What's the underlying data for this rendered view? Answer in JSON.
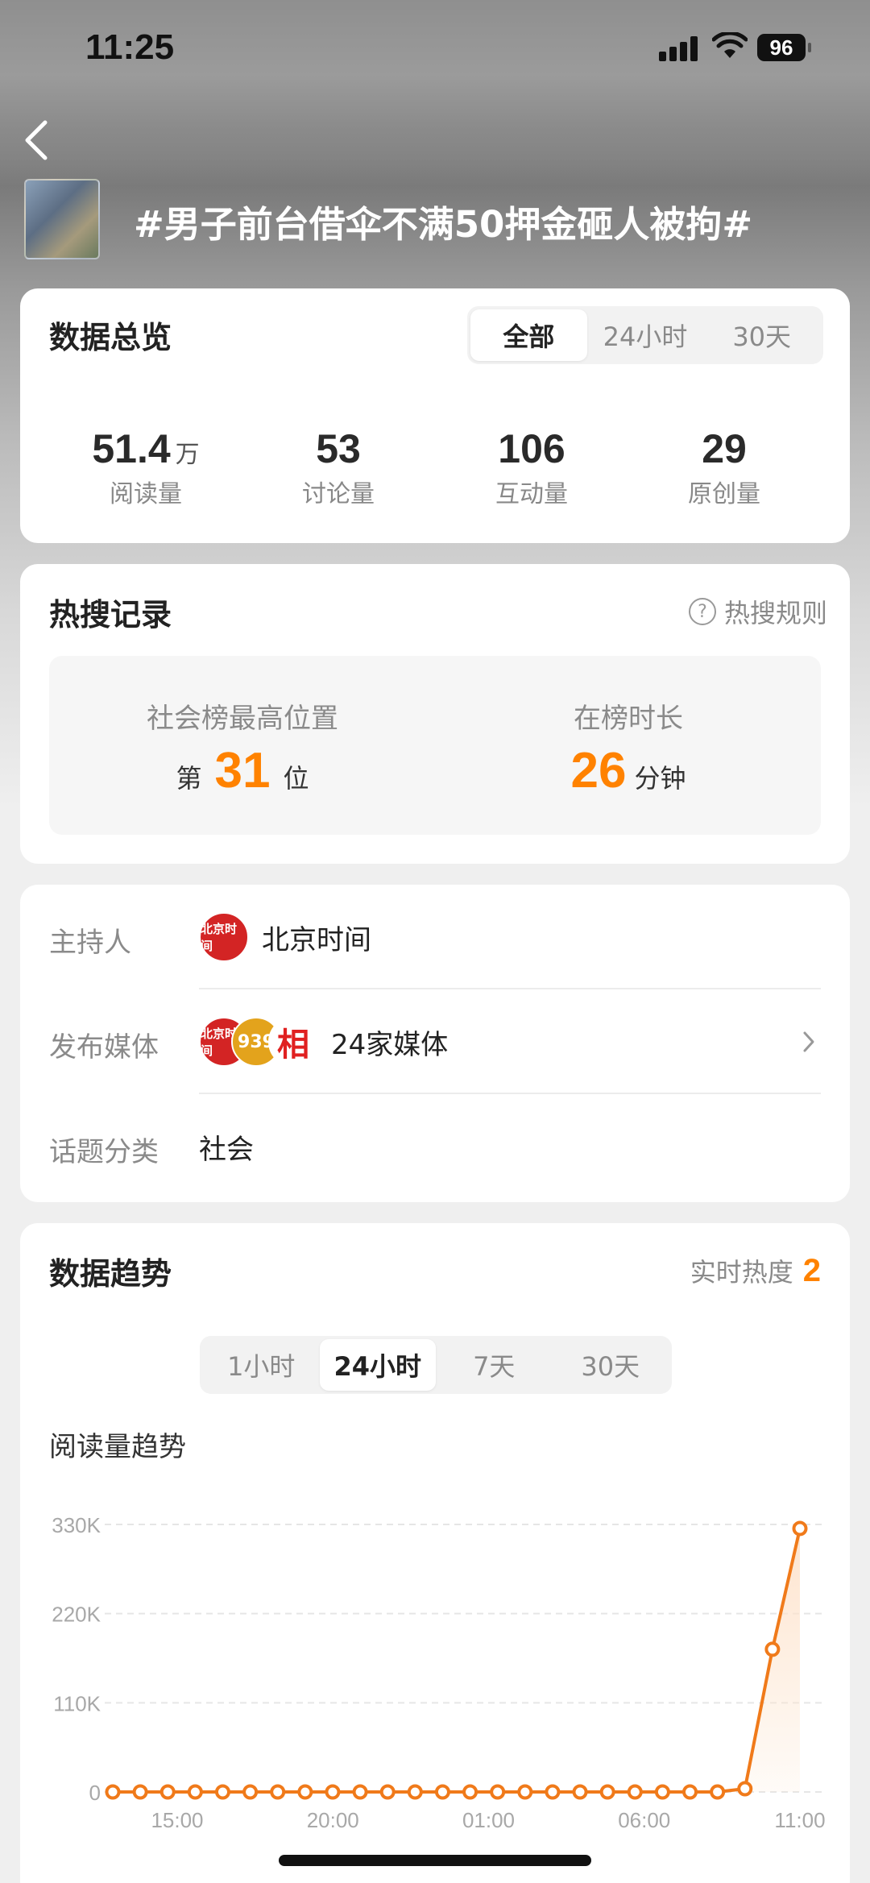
{
  "status": {
    "time": "11:25",
    "battery": "96"
  },
  "topic": {
    "title": "#男子前台借伞不满50押金砸人被拘#"
  },
  "overview": {
    "title": "数据总览",
    "tabs": [
      {
        "label": "全部",
        "active": true
      },
      {
        "label": "24小时",
        "active": false
      },
      {
        "label": "30天",
        "active": false
      }
    ],
    "stats": [
      {
        "value": "51.4",
        "unit": "万",
        "label": "阅读量"
      },
      {
        "value": "53",
        "unit": "",
        "label": "讨论量"
      },
      {
        "value": "106",
        "unit": "",
        "label": "互动量"
      },
      {
        "value": "29",
        "unit": "",
        "label": "原创量"
      }
    ]
  },
  "hot_search": {
    "title": "热搜记录",
    "rules_label": "热搜规则",
    "peak": {
      "label": "社会榜最高位置",
      "prefix": "第",
      "value": "31",
      "suffix": "位"
    },
    "duration": {
      "label": "在榜时长",
      "value": "26",
      "suffix": "分钟"
    }
  },
  "info": {
    "host": {
      "label": "主持人",
      "logo_text": "北京时间",
      "value": "北京时间"
    },
    "media": {
      "label": "发布媒体",
      "logos": [
        "北京时间",
        "939",
        "相"
      ],
      "value": "24家媒体"
    },
    "category": {
      "label": "话题分类",
      "value": "社会"
    }
  },
  "trend": {
    "title": "数据趋势",
    "realtime_label": "实时热度",
    "realtime_value": "2",
    "tabs": [
      {
        "label": "1小时",
        "active": false
      },
      {
        "label": "24小时",
        "active": true
      },
      {
        "label": "7天",
        "active": false
      },
      {
        "label": "30天",
        "active": false
      }
    ],
    "subtitle": "阅读量趋势"
  },
  "chart_data": {
    "type": "line",
    "title": "阅读量趋势",
    "y_ticks": [
      "0",
      "110K",
      "220K",
      "330K"
    ],
    "ylim": [
      0,
      330000
    ],
    "x_ticks": [
      "15:00",
      "20:00",
      "01:00",
      "06:00",
      "11:00"
    ],
    "values": [
      0,
      0,
      0,
      0,
      0,
      0,
      0,
      0,
      0,
      0,
      0,
      0,
      0,
      0,
      0,
      0,
      0,
      0,
      0,
      0,
      0,
      0,
      0,
      4000,
      176000,
      325000
    ],
    "grid": true,
    "colors": {
      "line": "#f07a1a",
      "fill": "#fde3cc"
    }
  },
  "colors": {
    "accent": "#ff8200",
    "background": "#efefef",
    "card": "#ffffff"
  }
}
